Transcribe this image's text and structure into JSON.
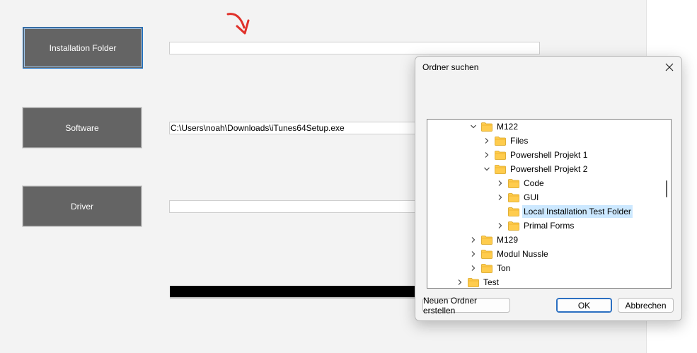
{
  "form": {
    "buttons": {
      "installation_folder": "Installation Folder",
      "software": "Software",
      "driver": "Driver"
    },
    "fields": {
      "installation_folder_path": "",
      "software_path": "C:\\Users\\noah\\Downloads\\iTunes64Setup.exe",
      "driver_path": ""
    },
    "progress": {
      "value": 1.0,
      "color": "#000000"
    },
    "annotation_color": "#e0312a"
  },
  "dialog": {
    "title": "Ordner suchen",
    "description": "",
    "tree": [
      {
        "label": "M122",
        "expanded": true
      },
      {
        "label": "Files",
        "expanded": false
      },
      {
        "label": "Powershell Projekt 1",
        "expanded": false
      },
      {
        "label": "Powershell Projekt 2",
        "expanded": true
      },
      {
        "label": "Code",
        "expanded": false
      },
      {
        "label": "GUI",
        "expanded": false
      },
      {
        "label": "Local Installation Test Folder",
        "selected": true
      },
      {
        "label": "Primal Forms",
        "expanded": false
      },
      {
        "label": "M129",
        "expanded": false
      },
      {
        "label": "Modul Nussle",
        "expanded": false
      },
      {
        "label": "Ton",
        "expanded": false
      },
      {
        "label": "Test",
        "expanded": false
      }
    ],
    "buttons": {
      "new_folder": "Neuen Ordner erstellen",
      "ok": "OK",
      "cancel": "Abbrechen"
    },
    "selection_color": "#cce8ff",
    "folder_color": "#ffcc4d"
  }
}
